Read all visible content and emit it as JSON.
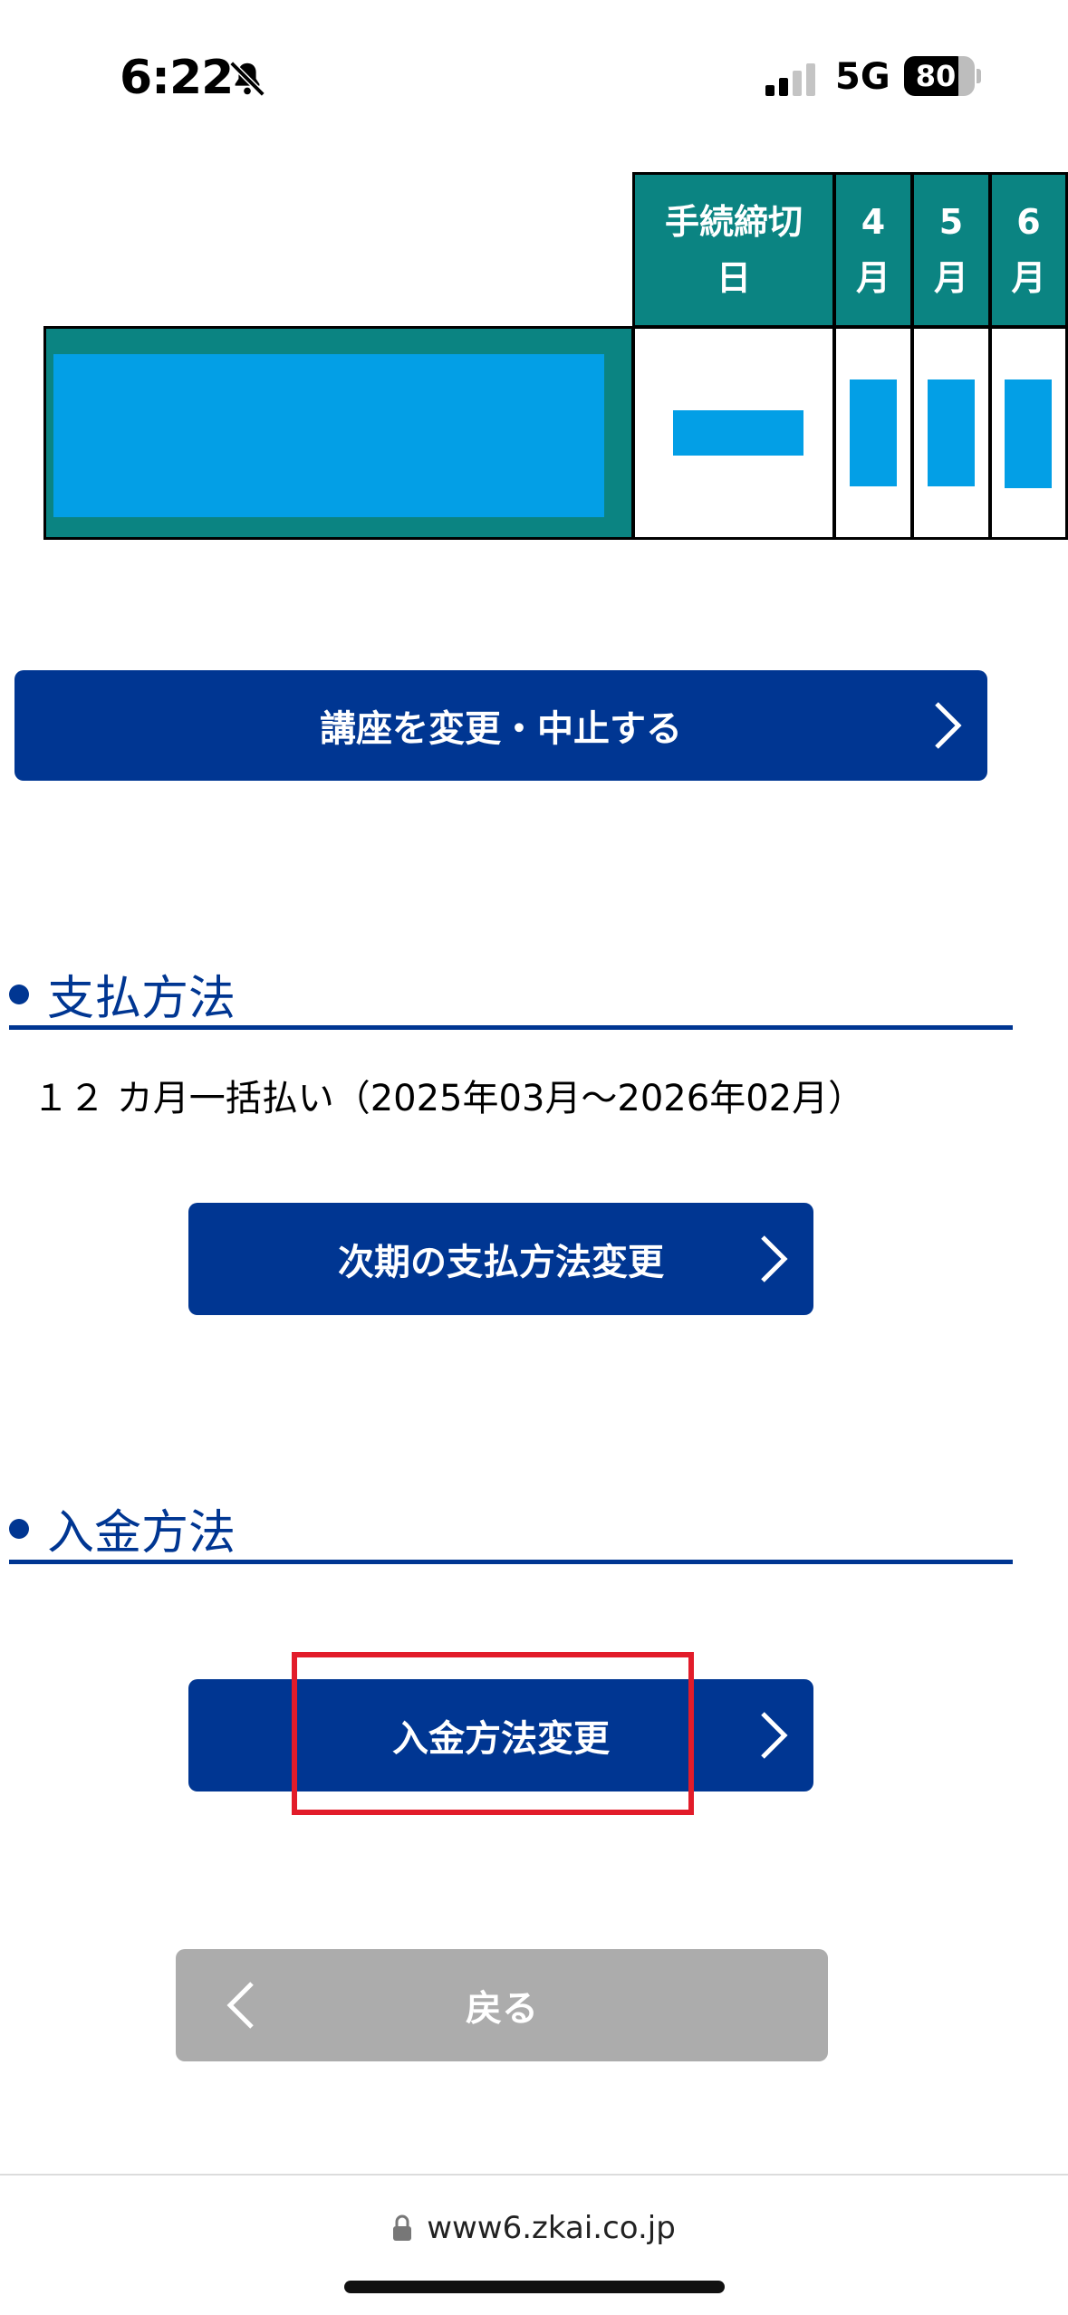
{
  "status_bar": {
    "time": "6:22",
    "network": "5G",
    "battery": "80",
    "icons": {
      "bell": "bell-slash-icon",
      "signal": "signal-icon"
    }
  },
  "schedule": {
    "headers": [
      "手続締切日",
      "4月",
      "5月",
      "6月"
    ],
    "header_lines": [
      [
        "手続締切",
        "日"
      ],
      [
        "4",
        "月"
      ],
      [
        "5",
        "月"
      ],
      [
        "6",
        "月"
      ]
    ]
  },
  "buttons": {
    "change_course": "講座を変更・中止する",
    "change_next_payment": "次期の支払方法変更",
    "change_deposit": "入金方法変更",
    "back": "戻る"
  },
  "sections": {
    "payment_method": {
      "title": "支払方法",
      "value": "１２ カ月一括払い（2025年03月～2026年02月）"
    },
    "deposit_method": {
      "title": "入金方法"
    }
  },
  "browser": {
    "url": "www6.zkai.co.jp"
  },
  "colors": {
    "primary": "#003692",
    "teal": "#0b8482",
    "mask": "#039fe6",
    "back_button": "#acacac",
    "highlight": "#e21c2a"
  }
}
